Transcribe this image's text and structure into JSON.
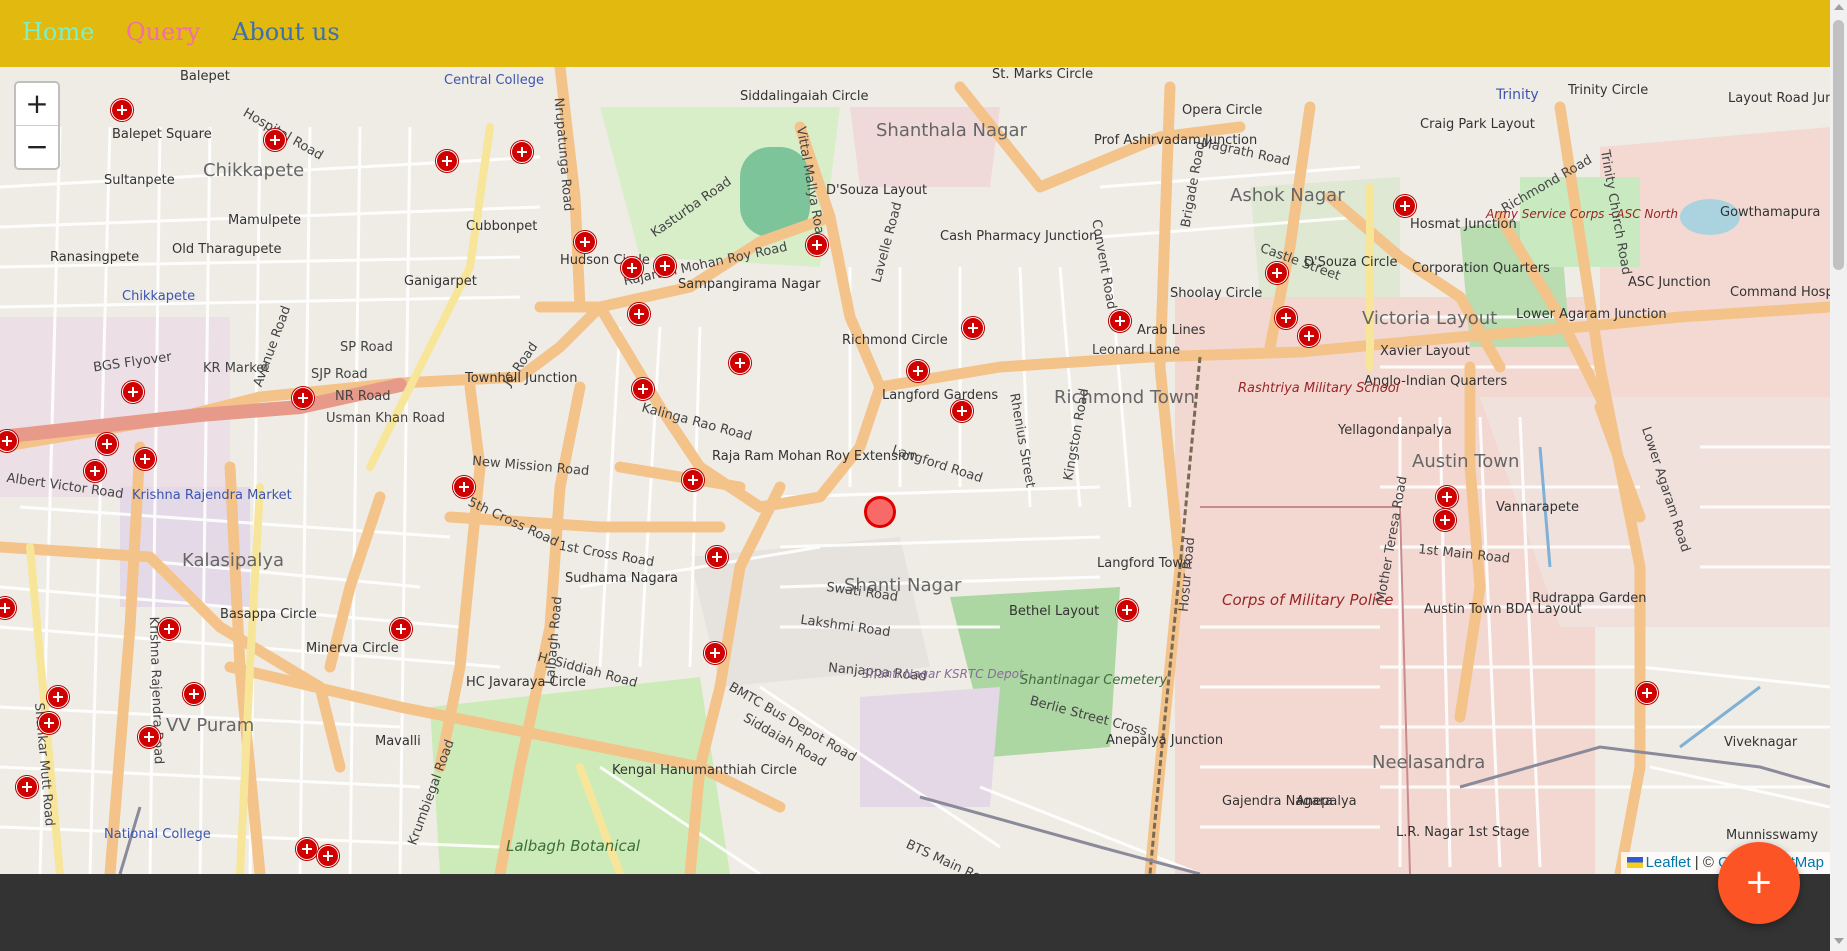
{
  "nav": {
    "background": "#e1b90f",
    "links": [
      {
        "label": "Home",
        "color": "#7df0c8"
      },
      {
        "label": "Query",
        "color": "#f06fa8"
      },
      {
        "label": "About us",
        "color": "#3a6fb0"
      }
    ]
  },
  "map": {
    "zoom_in": "+",
    "zoom_out": "−",
    "attribution": {
      "leaflet": "Leaflet",
      "separator": " | © ",
      "osm": "OpenStreetMap"
    },
    "hospital_marker_icon": "hospital-cross-icon",
    "current_location_icon": "current-location-circle-icon",
    "labels": {
      "areas": [
        "Chikkapete",
        "Shanthala Nagar",
        "Ashok Nagar",
        "Richmond Town",
        "Shanti Nagar",
        "Kalasipalya",
        "VV Puram",
        "Victoria Layout",
        "Austin Town",
        "Neelasandra",
        "Sampangirama Nagar",
        "Langford Gardens",
        "Raja Ram Mohan Roy Extension",
        "Sudhama Nagara",
        "Bethel Layout",
        "Langford Town",
        "Vannarapete",
        "Rudrappa Garden",
        "Viveknagar",
        "Balepet Square",
        "Sultanpete",
        "Mamulpete",
        "Ranasingpete",
        "Old Tharagupete",
        "Cubbonpet",
        "Ganigarpet",
        "Xavier Layout",
        "Anglo-Indian Quarters",
        "Yellagondanpalya",
        "Corporation Quarters",
        "Arab Lines",
        "Mavalli",
        "Gajendra Nagara",
        "Anepalya",
        "L.R. Nagar 1st Stage",
        "Munnisswamy",
        "Austin Town BDA Layout",
        "Balepet",
        "Gowthamapura",
        "Craig Park Layout"
      ],
      "roads": [
        "BGS Flyover",
        "SJP Road",
        "NR Road",
        "KR Market",
        "Usman Khan Road",
        "JC Road",
        "Kalinga Rao Road",
        "New Mission Road",
        "Lalbagh Road",
        "H. Siddiah Road",
        "Siddaiah Road",
        "Kasturba Road",
        "Rajaram Mohan Roy Road",
        "Nrupatunga Road",
        "Vittal Mallya Road",
        "Langford Road",
        "Rhenius Street",
        "Brigade Road",
        "Hosur Road",
        "Magrath Road",
        "Richmond Road",
        "Trinity Church Road",
        "Lower Agaram Road",
        "Mother Teresa Road",
        "1st Main Road",
        "Albert Victor Road",
        "Krishna Rajendra Road",
        "BTS Main Road",
        "BMTC Bus Depot Road",
        "Berlie Street Cross",
        "Swati Road",
        "Lakshmi Road",
        "Nanjappa Road",
        "5th Cross Road",
        "1st Cross Road",
        "Kingston Road",
        "Convent Road",
        "Leonard Lane",
        "Lavelle Road",
        "Castle Street",
        "Krumbiegal Road",
        "Shankar Mutt Road",
        "Avenue Road",
        "Hospital Road",
        "SP Road"
      ],
      "junctions": [
        "Hudson Circle",
        "Siddalingaiah Circle",
        "Richmond Circle",
        "Cash Pharmacy Junction",
        "Prof Ashirvadam Junction",
        "Opera Circle",
        "Shoolay Circle",
        "D'Souza Circle",
        "Hosmat Junction",
        "Trinity Circle",
        "ASC Junction",
        "Lower Agaram Junction",
        "Command Hospital Junction",
        "Townhall Junction",
        "Basappa Circle",
        "Minerva Circle",
        "HC Javaraya Circle",
        "Kengal Hanumanthiah Circle",
        "Anepalya Junction",
        "Layout Road Junction",
        "St. Marks Circle",
        "D'Souza Layout"
      ],
      "military": [
        "Rashtriya Military School",
        "Corps of Military Police",
        "Army Service Corps - ASC North"
      ],
      "parks": [
        "Shantinagar Cemetery",
        "Lalbagh Botanical",
        "Shanti Nagar KSRTC Depot"
      ],
      "pois": [
        "Chikkapete",
        "Krishna Rajendra Market",
        "Trinity",
        "National College",
        "Central College"
      ]
    }
  },
  "fab": {
    "label": "+",
    "color": "#fc5424"
  },
  "footer": {
    "color": "#333333"
  }
}
